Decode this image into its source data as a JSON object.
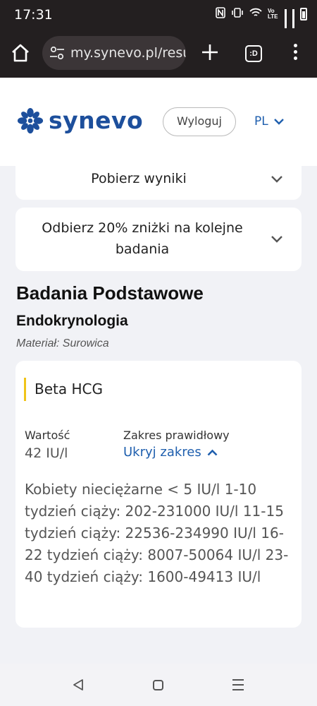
{
  "status_bar": {
    "time": "17:31",
    "network_label": "Vo LTE"
  },
  "browser": {
    "url": "my.synevo.pl/resu",
    "tabs_label": ":D"
  },
  "header": {
    "logo_text": "synevo",
    "logout_label": "Wyloguj",
    "language": "PL"
  },
  "accordions": [
    {
      "label": "Pobierz wyniki"
    },
    {
      "label": "Odbierz 20% zniżki na kolejne badania"
    }
  ],
  "section": {
    "title": "Badania Podstawowe",
    "subsection": "Endokrynologia",
    "material": "Materiał: Surowica"
  },
  "result": {
    "test_name": "Beta HCG",
    "value_label": "Wartość",
    "value": "42 IU/l",
    "range_label": "Zakres prawidłowy",
    "toggle_label": "Ukryj zakres",
    "range_text": "Kobiety nieciężarne < 5 IU/l 1-10 tydzień ciąży: 202-231000 IU/l 11-15 tydzień ciąży: 22536-234990 IU/l 16-22 tydzień ciąży: 8007-50064 IU/l 23-40 tydzień ciąży: 1600-49413 IU/l"
  },
  "colors": {
    "brand": "#1d4f9c",
    "link": "#1f5fae",
    "accent_bar": "#f0c419",
    "browser_chrome": "#231f20"
  },
  "icons": [
    "home-icon",
    "tune-icon",
    "plus-icon",
    "tabs-icon",
    "more-vert-icon",
    "chevron-down-icon",
    "chevron-up-icon",
    "nav-back-icon",
    "nav-home-icon",
    "nav-recent-icon"
  ]
}
